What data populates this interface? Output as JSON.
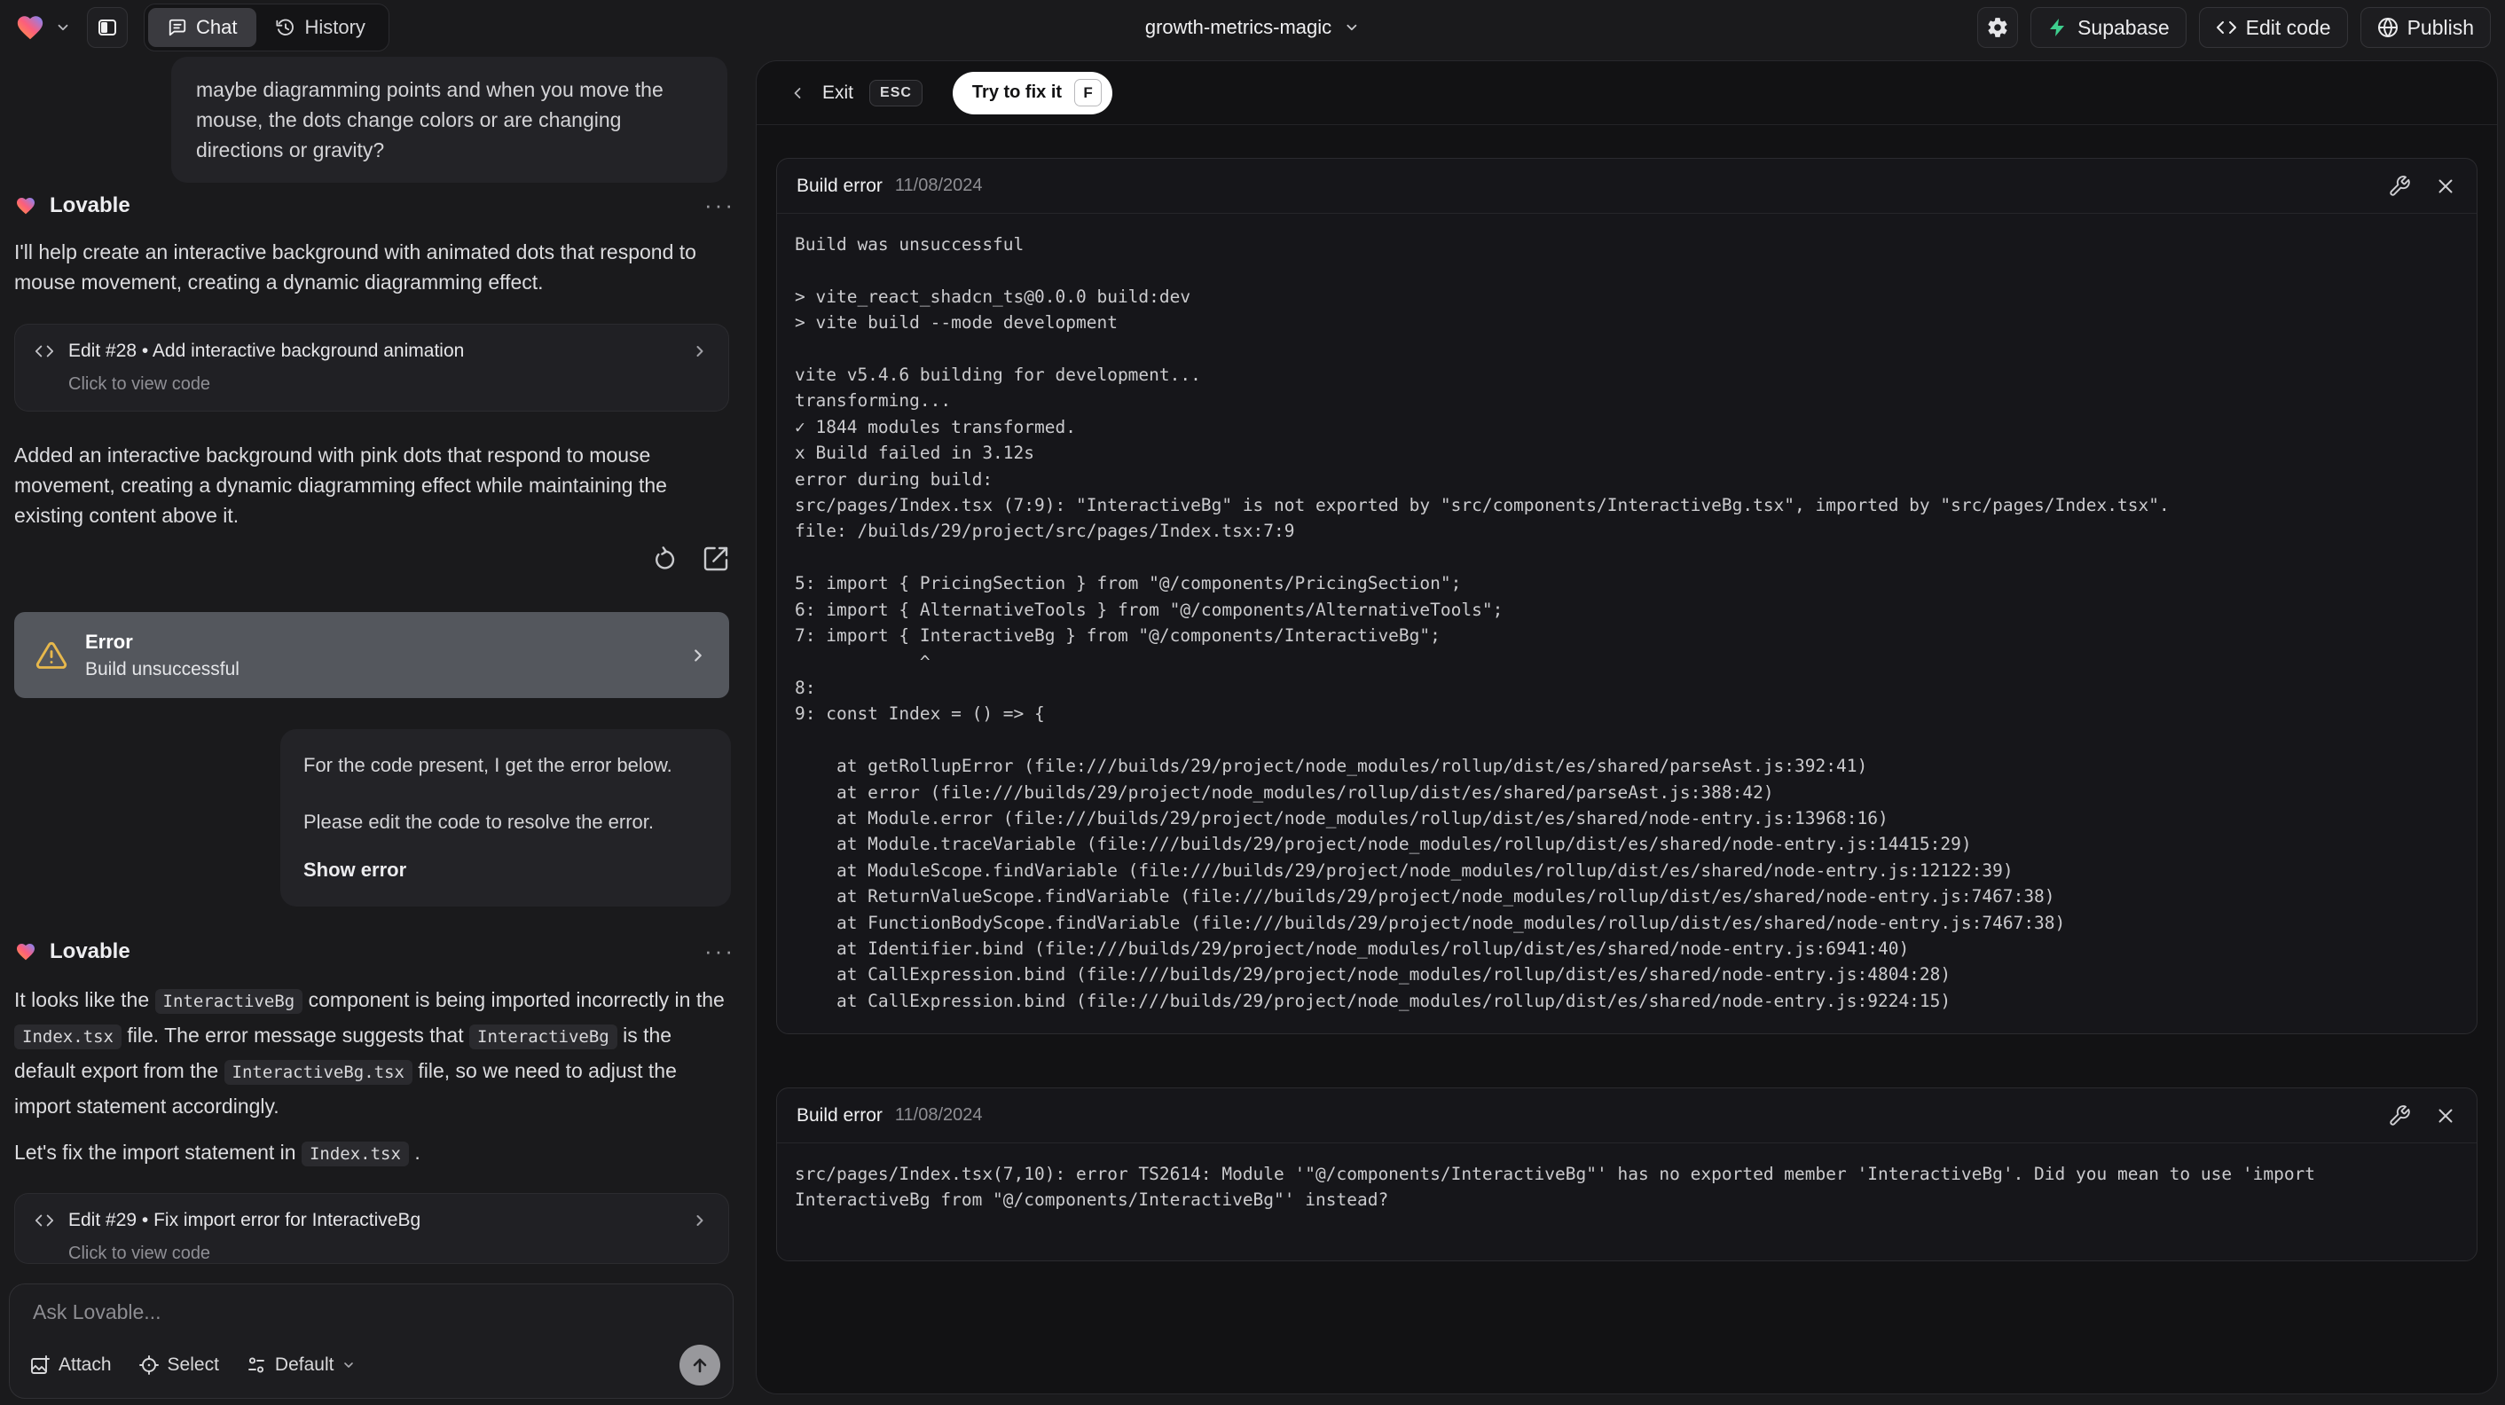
{
  "topbar": {
    "project_name": "growth-metrics-magic",
    "tab_chat": "Chat",
    "tab_history": "History",
    "supabase_label": "Supabase",
    "edit_code_label": "Edit code",
    "publish_label": "Publish"
  },
  "chat": {
    "assistant_name": "Lovable",
    "menu_dots": "···",
    "user_msg1": "maybe diagramming points and when you move the mouse, the dots change colors or are changing directions or gravity?",
    "msg1_intro": "I'll help create an interactive background with animated dots that respond to mouse movement, creating a dynamic diagramming effect.",
    "edit28": {
      "title": "Edit #28 • Add interactive background animation",
      "subtitle": "Click to view code"
    },
    "msg1_summary": "Added an interactive background with pink dots that respond to mouse movement, creating a dynamic diagramming effect while maintaining the existing content above it.",
    "error_card": {
      "title": "Error",
      "subtitle": "Build unsuccessful"
    },
    "user_msg2": {
      "line1": "For the code present, I get the error below.",
      "line2": "Please edit the code to resolve the error.",
      "action": "Show error"
    },
    "msg2_p1": [
      {
        "t": "It looks like the "
      },
      {
        "c": "InteractiveBg"
      },
      {
        "t": " component is being imported incorrectly in the "
      },
      {
        "c": "Index.tsx"
      },
      {
        "t": " file. The error message suggests that "
      },
      {
        "c": "InteractiveBg"
      },
      {
        "t": " is the default export from the "
      },
      {
        "c": "InteractiveBg.tsx"
      },
      {
        "t": " file, so we need to adjust the import statement accordingly."
      }
    ],
    "msg2_p2": [
      {
        "t": "Let's fix the import statement in "
      },
      {
        "c": "Index.tsx"
      },
      {
        "t": " ."
      }
    ],
    "edit29": {
      "title": "Edit #29 • Fix import error for InteractiveBg",
      "subtitle": "Click to view code"
    }
  },
  "composer": {
    "placeholder": "Ask Lovable...",
    "attach_label": "Attach",
    "select_label": "Select",
    "mode_label": "Default"
  },
  "fix_panel": {
    "exit_label": "Exit",
    "esc_key": "ESC",
    "fix_button_label": "Try to fix it",
    "f_key": "F",
    "error1": {
      "title": "Build error",
      "date": "11/08/2024",
      "log_lines": [
        "Build was unsuccessful",
        "",
        "> vite_react_shadcn_ts@0.0.0 build:dev",
        "> vite build --mode development",
        "",
        "vite v5.4.6 building for development...",
        "transforming...",
        "✓ 1844 modules transformed.",
        "x Build failed in 3.12s",
        "error during build:",
        "src/pages/Index.tsx (7:9): \"InteractiveBg\" is not exported by \"src/components/InteractiveBg.tsx\", imported by \"src/pages/Index.tsx\".",
        "file: /builds/29/project/src/pages/Index.tsx:7:9",
        "",
        "5: import { PricingSection } from \"@/components/PricingSection\";",
        "6: import { AlternativeTools } from \"@/components/AlternativeTools\";",
        "7: import { InteractiveBg } from \"@/components/InteractiveBg\";",
        "            ^",
        "8: ",
        "9: const Index = () => {",
        "",
        "    at getRollupError (file:///builds/29/project/node_modules/rollup/dist/es/shared/parseAst.js:392:41)",
        "    at error (file:///builds/29/project/node_modules/rollup/dist/es/shared/parseAst.js:388:42)",
        "    at Module.error (file:///builds/29/project/node_modules/rollup/dist/es/shared/node-entry.js:13968:16)",
        "    at Module.traceVariable (file:///builds/29/project/node_modules/rollup/dist/es/shared/node-entry.js:14415:29)",
        "    at ModuleScope.findVariable (file:///builds/29/project/node_modules/rollup/dist/es/shared/node-entry.js:12122:39)",
        "    at ReturnValueScope.findVariable (file:///builds/29/project/node_modules/rollup/dist/es/shared/node-entry.js:7467:38)",
        "    at FunctionBodyScope.findVariable (file:///builds/29/project/node_modules/rollup/dist/es/shared/node-entry.js:7467:38)",
        "    at Identifier.bind (file:///builds/29/project/node_modules/rollup/dist/es/shared/node-entry.js:6941:40)",
        "    at CallExpression.bind (file:///builds/29/project/node_modules/rollup/dist/es/shared/node-entry.js:4804:28)",
        "    at CallExpression.bind (file:///builds/29/project/node_modules/rollup/dist/es/shared/node-entry.js:9224:15)"
      ]
    },
    "error2": {
      "title": "Build error",
      "date": "11/08/2024",
      "message_lines": [
        "src/pages/Index.tsx(7,10): error TS2614: Module '\"@/components/InteractiveBg\"' has no exported member 'InteractiveBg'. Did you mean to use 'import",
        "InteractiveBg from \"@/components/InteractiveBg\"' instead?"
      ]
    }
  },
  "colors": {
    "accent_supabase": "#3ecf8e",
    "warning": "#e7b84c",
    "fix_button_bg": "#ffffff",
    "panel_bg": "#121214"
  }
}
